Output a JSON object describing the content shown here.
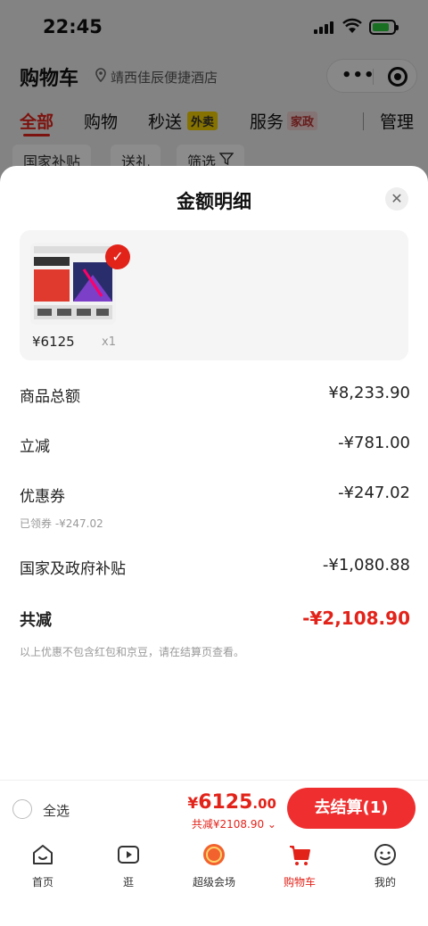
{
  "status": {
    "time": "22:45"
  },
  "header": {
    "title": "购物车",
    "location": "靖西佳辰便捷酒店"
  },
  "tabs": [
    {
      "label": "全部"
    },
    {
      "label": "购物"
    },
    {
      "label": "秒送",
      "badge": "外卖"
    },
    {
      "label": "服务",
      "badge": "家政"
    },
    {
      "label": "管理"
    }
  ],
  "chips": [
    "国家补贴",
    "送礼",
    "筛选"
  ],
  "sheet": {
    "title": "金额明细",
    "product": {
      "price": "¥6125",
      "qty": "x1"
    },
    "rows": [
      {
        "label": "商品总额",
        "value": "¥8,233.90"
      },
      {
        "label": "立减",
        "value": "-¥781.00"
      },
      {
        "label": "优惠券",
        "value": "-¥247.02",
        "sub": "已领券 -¥247.02"
      },
      {
        "label": "国家及政府补贴",
        "value": "-¥1,080.88"
      },
      {
        "label": "共减",
        "value": "-¥2,108.90"
      }
    ],
    "note": "以上优惠不包含红包和京豆，请在结算页查看。"
  },
  "checkout": {
    "select_all": "全选",
    "price_currency": "¥",
    "price_int": "6125",
    "price_dec": ".00",
    "discount": "共减¥2108.90 ⌄",
    "button": "去结算(1)"
  },
  "tabbar": [
    {
      "label": "首页",
      "icon": "home-icon"
    },
    {
      "label": "逛",
      "icon": "video-icon"
    },
    {
      "label": "超级会场",
      "icon": "super-venue-icon"
    },
    {
      "label": "购物车",
      "icon": "cart-icon"
    },
    {
      "label": "我的",
      "icon": "profile-icon"
    }
  ],
  "colors": {
    "accent": "#e2231a",
    "button": "#ef2f2f"
  }
}
